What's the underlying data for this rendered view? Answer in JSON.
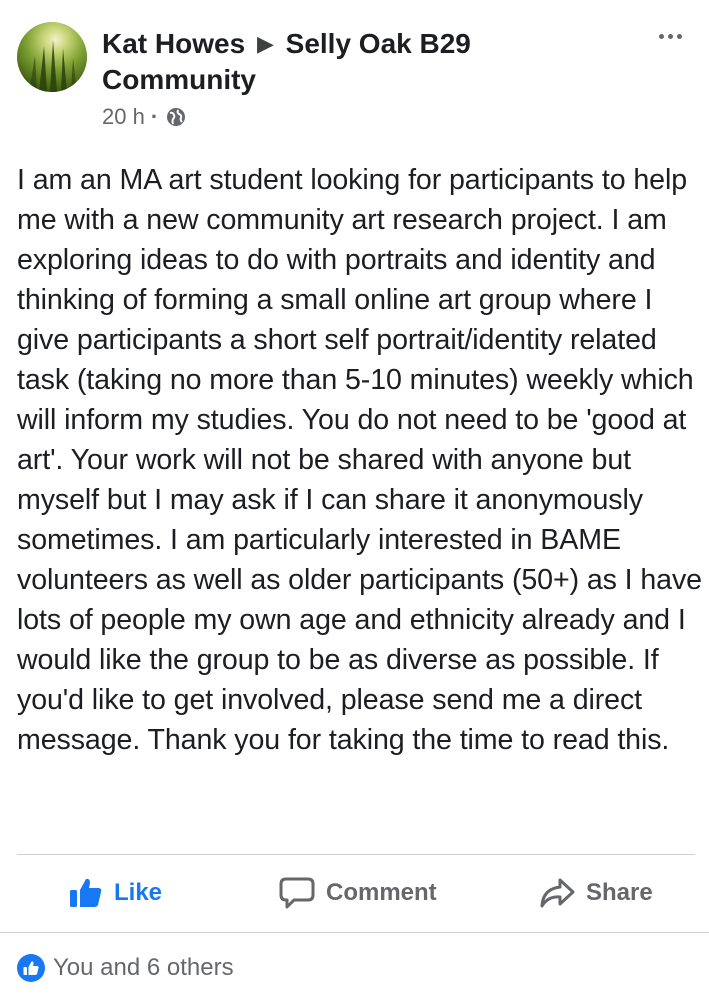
{
  "post": {
    "author": "Kat Howes",
    "group": "Selly Oak B29 Community",
    "timestamp": "20 h",
    "separator": "·",
    "privacy_icon": "globe-icon",
    "menu_icon": "more-horizontal-icon",
    "body": "I am an MA art student looking for participants to help me with a new community art research project. I am exploring ideas to do with portraits and identity and thinking of forming a small online art group where I give participants a short self portrait/identity related task (taking no more than 5-10 minutes) weekly which will inform my studies. You do not need to be 'good at art'. Your work will not be shared with anyone but myself but I may ask if I can share it anonymously sometimes. I am particularly interested in BAME volunteers as well as older participants (50+) as I have lots of people my own age and ethnicity already and I would like the group to be as diverse as possible. If you'd like to get involved, please send me a direct message. Thank you for taking the time to read this."
  },
  "actions": {
    "like_label": "Like",
    "like_icon": "thumbs-up-icon",
    "comment_label": "Comment",
    "comment_icon": "speech-bubble-icon",
    "share_label": "Share",
    "share_icon": "share-arrow-icon"
  },
  "reactions": {
    "icon": "like-reaction-icon",
    "text": "You and 6 others"
  },
  "colors": {
    "accent": "#1877f2",
    "secondary_text": "#65676b",
    "primary_text": "#1c1e21",
    "divider": "#ced0d4"
  }
}
